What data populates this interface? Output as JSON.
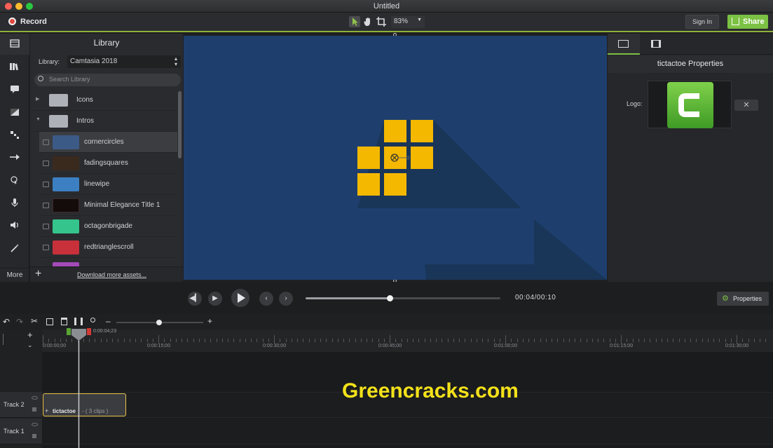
{
  "window": {
    "title": "Untitled"
  },
  "toolbar": {
    "record_label": "Record",
    "zoom_value": "83%",
    "sign_in_label": "Sign In",
    "share_label": "Share"
  },
  "iconbar": {
    "items": [
      "media-icon",
      "library-icon",
      "annotations-icon",
      "transitions-icon",
      "behaviors-icon",
      "animations-icon",
      "cursor-effects-icon",
      "voice-narration-icon",
      "audio-effects-icon",
      "visual-effects-icon"
    ],
    "more_label": "More"
  },
  "library": {
    "title": "Library",
    "selector_label": "Library:",
    "selector_value": "Camtasia 2018",
    "search_placeholder": "Search Library",
    "folders": [
      {
        "name": "Icons",
        "expanded": false
      },
      {
        "name": "Intros",
        "expanded": true
      }
    ],
    "items": [
      {
        "name": "cornercircles",
        "thumb": "#3c5a86",
        "selected": true
      },
      {
        "name": "fadingsquares",
        "thumb": "#3a2a1e"
      },
      {
        "name": "linewipe",
        "thumb": "#3c7fc2"
      },
      {
        "name": "Minimal Elegance Title 1",
        "thumb": "#140b0b"
      },
      {
        "name": "octagonbrigade",
        "thumb": "#35c48c"
      },
      {
        "name": "redtrianglescroll",
        "thumb": "#c8303a"
      }
    ],
    "download_link": "Download more assets..."
  },
  "properties": {
    "title": "tictactoe Properties",
    "logo_label": "Logo:"
  },
  "playback": {
    "time_display": "00:04/00:10",
    "progress_fraction": 0.43,
    "properties_button": "Properties"
  },
  "timeline": {
    "playhead_time": "0:00:04;23",
    "ticks": [
      "0:00:00;00",
      "0:00:15;00",
      "0:00:30;00",
      "0:00:45;00",
      "0:01:00;00",
      "0:01:15;00",
      "0:01:30;00"
    ],
    "tracks": [
      {
        "name": "Track 2"
      },
      {
        "name": "Track 1"
      }
    ],
    "clip": {
      "name": "tictactoe",
      "info": "- ( 3 clips )"
    }
  },
  "watermark": "Greencracks.com",
  "colors": {
    "accent_green": "#7bc143",
    "canvas_blue": "#1e3f6e",
    "tile_yellow": "#f5b800",
    "record_red": "#e04a3f",
    "clip_outline": "#e8c34a"
  }
}
